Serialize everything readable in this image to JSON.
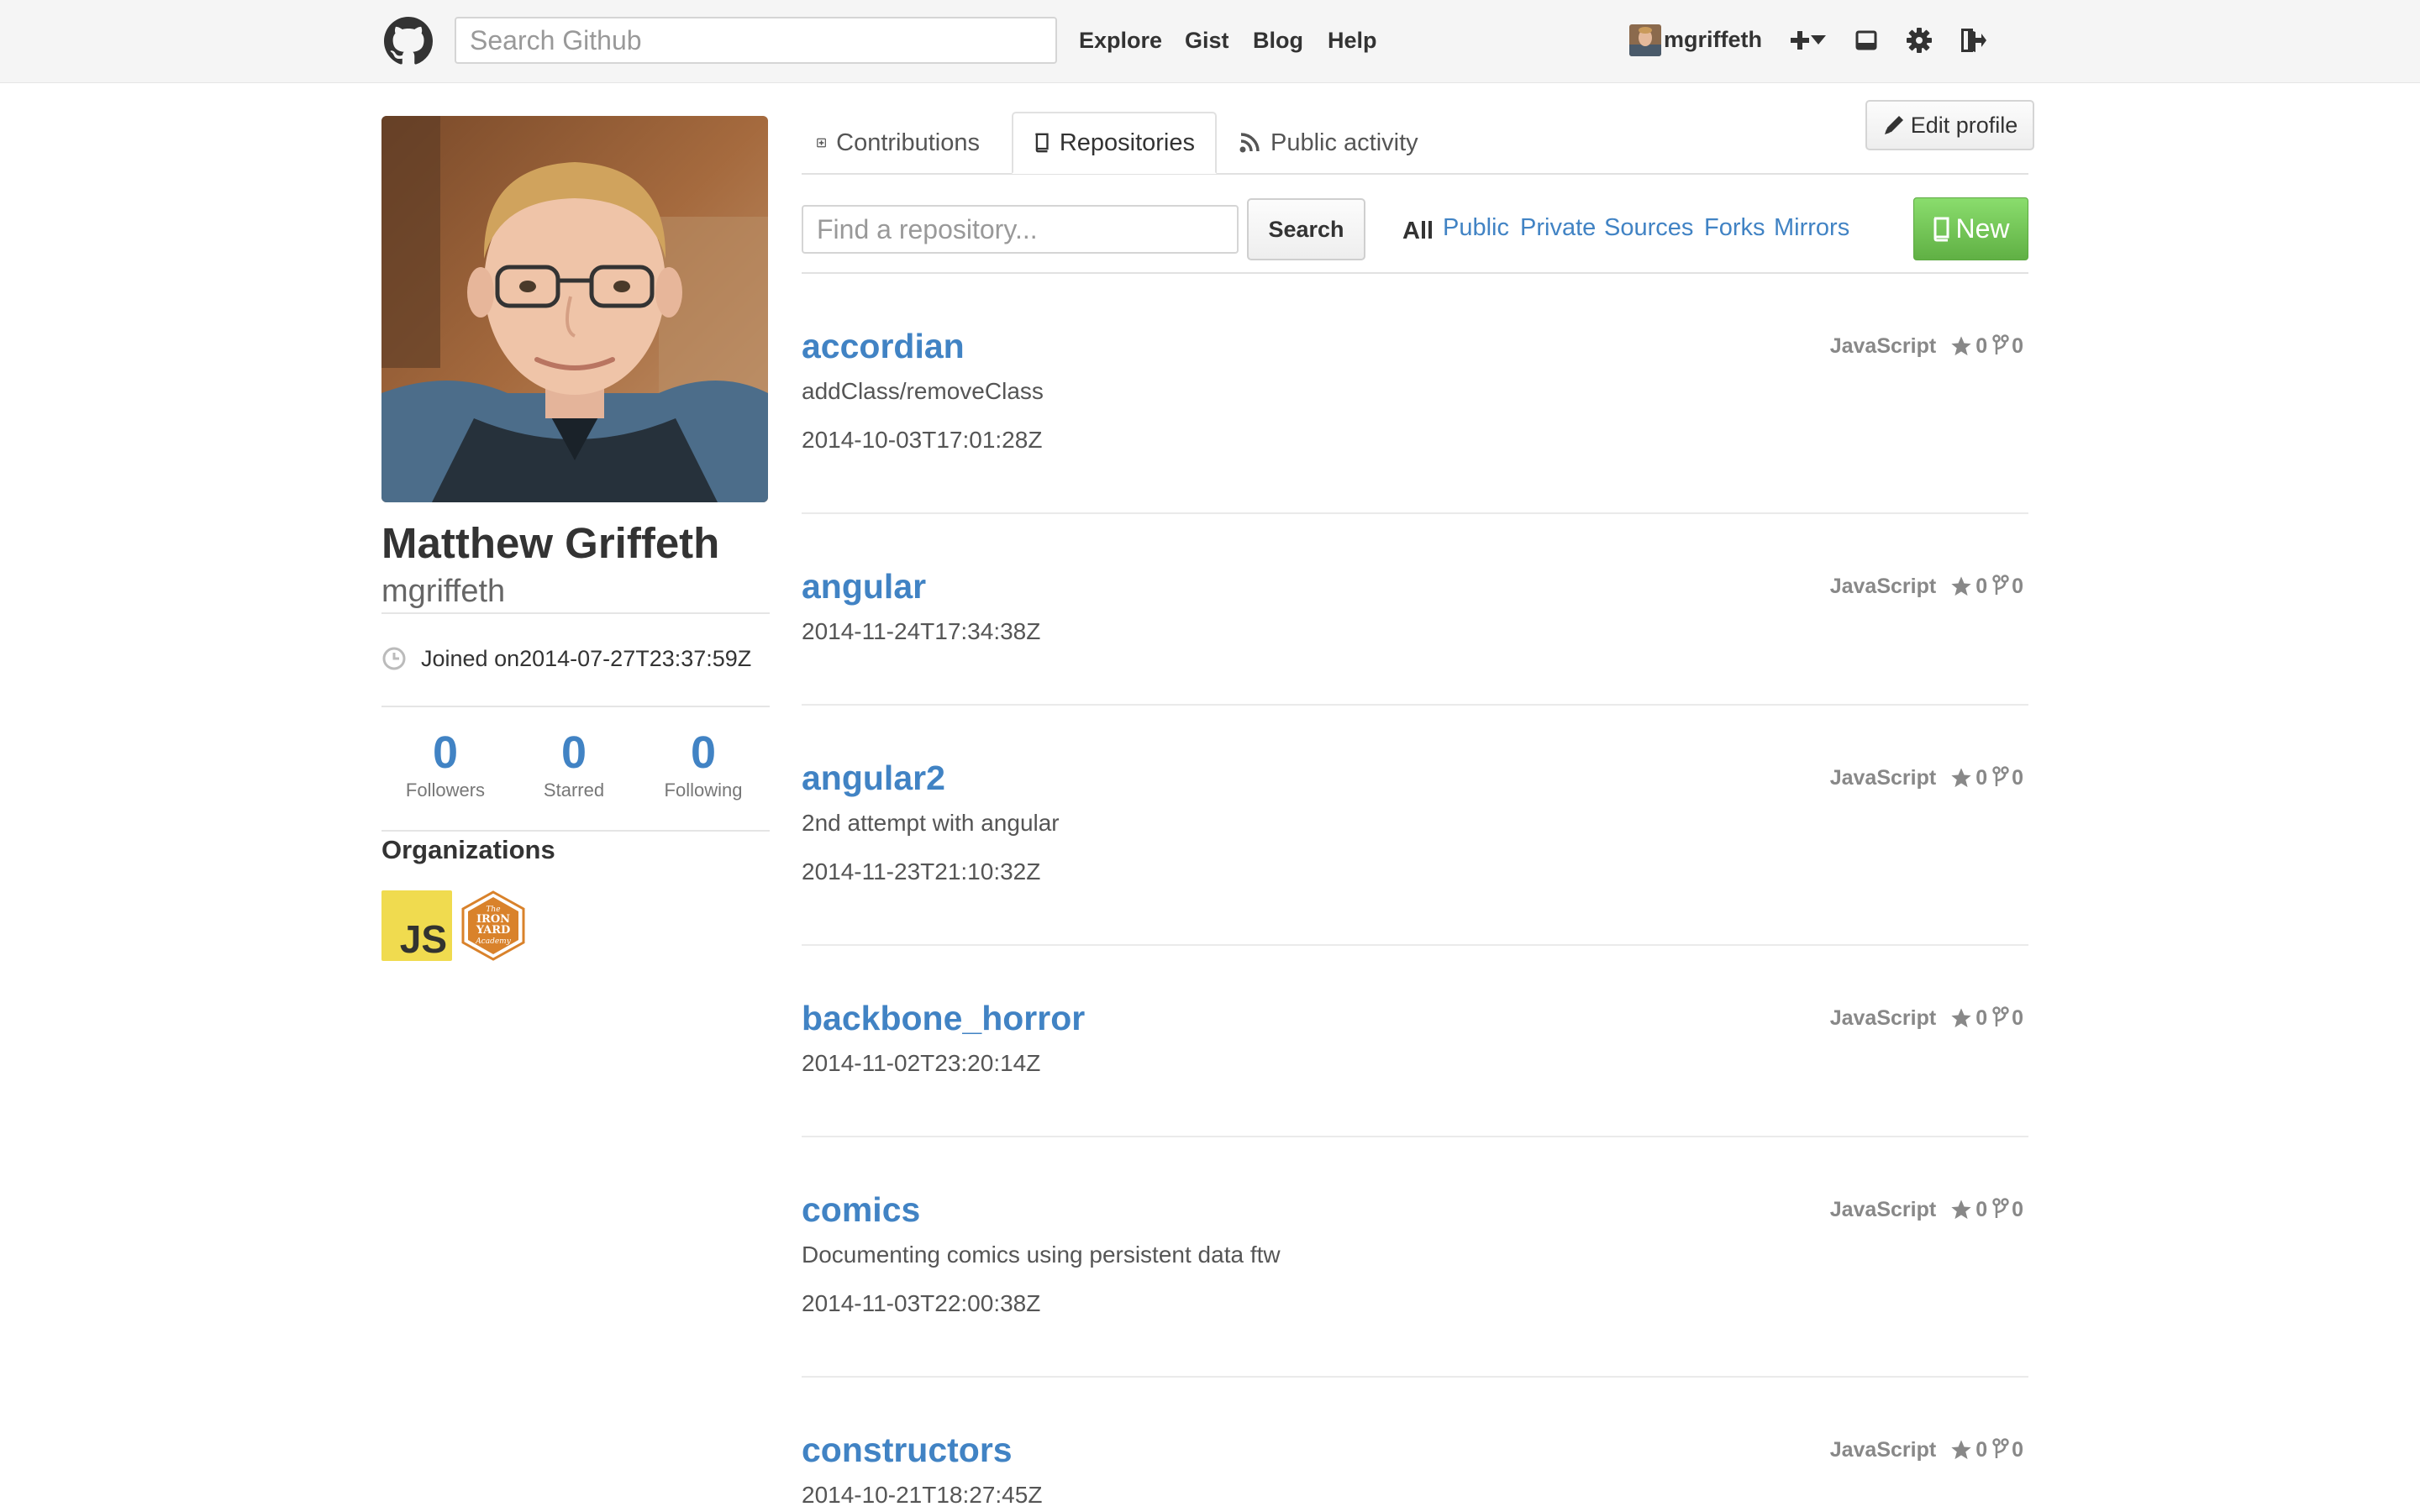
{
  "header": {
    "search_placeholder": "Search Github",
    "nav": [
      "Explore",
      "Gist",
      "Blog",
      "Help"
    ],
    "username": "mgriffeth",
    "icons": [
      "github-logo-icon",
      "plus-icon",
      "caret-down-icon",
      "inbox-icon",
      "gear-icon",
      "sign-out-icon"
    ]
  },
  "profile": {
    "full_name": "Matthew Griffeth",
    "login": "mgriffeth",
    "joined": "Joined on2014-07-27T23:37:59Z",
    "stats": [
      {
        "value": "0",
        "label": "Followers"
      },
      {
        "value": "0",
        "label": "Starred"
      },
      {
        "value": "0",
        "label": "Following"
      }
    ],
    "organizations_title": "Organizations",
    "orgs": [
      {
        "name": "javascript-org",
        "text": "JS",
        "color": "#f0db4f"
      },
      {
        "name": "iron-yard-academy-org",
        "text": [
          "The",
          "IRON",
          "YARD",
          "Academy"
        ],
        "color": "#d9822b"
      }
    ]
  },
  "tabs": [
    {
      "label": "Contributions",
      "icon": "plus-square-icon",
      "active": false
    },
    {
      "label": "Repositories",
      "icon": "repo-book-icon",
      "active": true
    },
    {
      "label": "Public activity",
      "icon": "rss-icon",
      "active": false
    }
  ],
  "edit_profile_label": "Edit profile",
  "filter": {
    "search_placeholder": "Find a repository...",
    "search_button": "Search",
    "all": "All",
    "links": [
      "Public",
      "Private",
      "Sources",
      "Forks",
      "Mirrors"
    ],
    "new_button": "New"
  },
  "repos": [
    {
      "name": "accordian",
      "description": "addClass/removeClass",
      "updated": "2014-10-03T17:01:28Z",
      "language": "JavaScript",
      "stars": "0",
      "forks": "0"
    },
    {
      "name": "angular",
      "description": "",
      "updated": "2014-11-24T17:34:38Z",
      "language": "JavaScript",
      "stars": "0",
      "forks": "0"
    },
    {
      "name": "angular2",
      "description": "2nd attempt with angular",
      "updated": "2014-11-23T21:10:32Z",
      "language": "JavaScript",
      "stars": "0",
      "forks": "0"
    },
    {
      "name": "backbone_horror",
      "description": "",
      "updated": "2014-11-02T23:20:14Z",
      "language": "JavaScript",
      "stars": "0",
      "forks": "0"
    },
    {
      "name": "comics",
      "description": "Documenting comics using persistent data ftw",
      "updated": "2014-11-03T22:00:38Z",
      "language": "JavaScript",
      "stars": "0",
      "forks": "0"
    },
    {
      "name": "constructors",
      "description": "",
      "updated": "2014-10-21T18:27:45Z",
      "language": "JavaScript",
      "stars": "0",
      "forks": "0"
    }
  ],
  "colors": {
    "link": "#4183c4",
    "new_button": "#60b044",
    "header_bg": "#f5f5f5"
  }
}
